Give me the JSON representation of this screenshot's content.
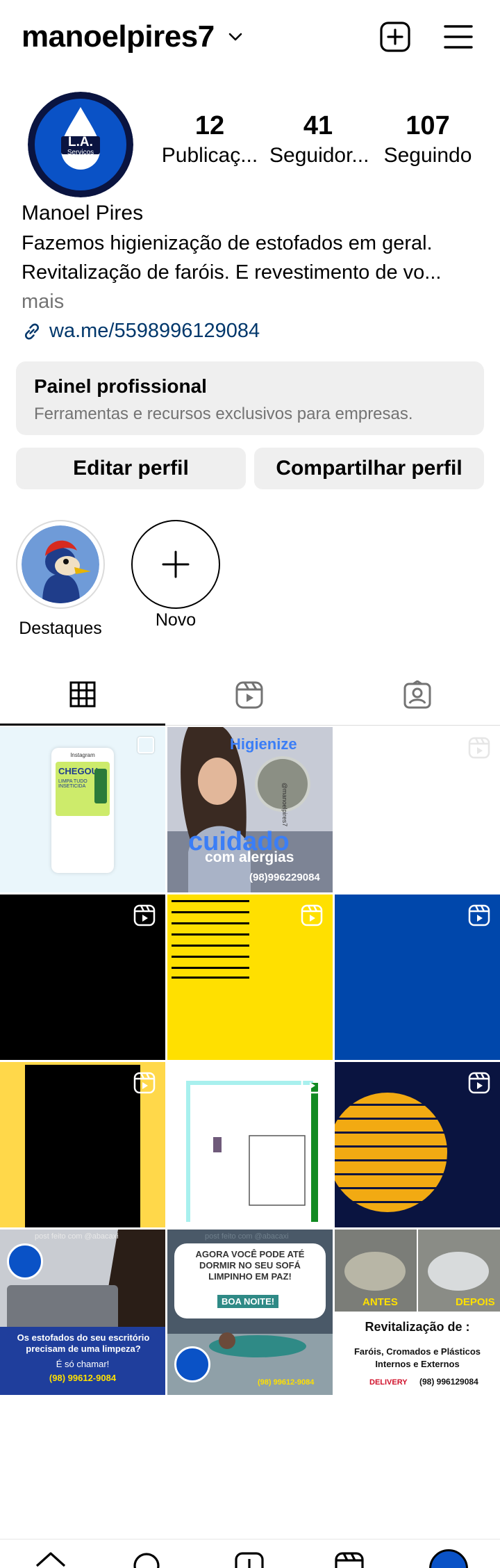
{
  "profile": {
    "username": "manoelpires7",
    "stats": [
      {
        "value": "12",
        "label": "Publicaç..."
      },
      {
        "value": "41",
        "label": "Seguidor..."
      },
      {
        "value": "107",
        "label": "Seguindo"
      }
    ],
    "display_name": "Manoel Pires",
    "bio_line1": "Fazemos higienização de estofados em geral.",
    "bio_line2": "Revitalização de faróis. E revestimento de vo...",
    "bio_more": "mais",
    "link": "wa.me/5598996129084",
    "avatar_text": "L.A.",
    "avatar_sub": "Serviços"
  },
  "panel": {
    "title": "Painel profissional",
    "subtitle": "Ferramentas e recursos exclusivos para empresas."
  },
  "buttons": {
    "edit": "Editar perfil",
    "share": "Compartilhar perfil"
  },
  "highlights": [
    {
      "label": "Destaques"
    },
    {
      "label": "Novo"
    }
  ],
  "posts": {
    "p1_brand": "Instagram",
    "p1_headline": "CHEGOU",
    "p1_sub": "LIMPA TUDO INSETICIDA",
    "p2_title": "Higienize",
    "p2_big": "cuidado",
    "p2_sub": "com alergias",
    "p2_phone": "(98)996229084",
    "p2_handle": "@manoelpires7",
    "p10_text": "Os estofados do seu escritório precisam de uma limpeza?",
    "p10_sub": "É só chamar!",
    "p10_phone": "(98) 99612-9084",
    "p10_top": "post feito com @abacaxi",
    "p11_top": "post feito com @abacaxi",
    "p11_text": "AGORA VOCÊ PODE ATÉ DORMIR NO SEU SOFÁ LIMPINHO EM PAZ!",
    "p11_badge": "BOA NOITE!",
    "p11_phone": "(98) 99612-9084",
    "p12_before": "ANTES",
    "p12_after": "DEPOIS",
    "p12_title": "Revitalização de :",
    "p12_line1": "Faróis, Cromados e Plásticos",
    "p12_line2": "Internos e Externos",
    "p12_delivery": "DELIVERY",
    "p12_phone": "(98) 996129084"
  },
  "colors": {
    "panel_bg": "#efefef",
    "link": "#00376b",
    "muted": "#737373",
    "yellow": "#ffe000",
    "blue": "#0047ab",
    "navy": "#0a1440"
  }
}
